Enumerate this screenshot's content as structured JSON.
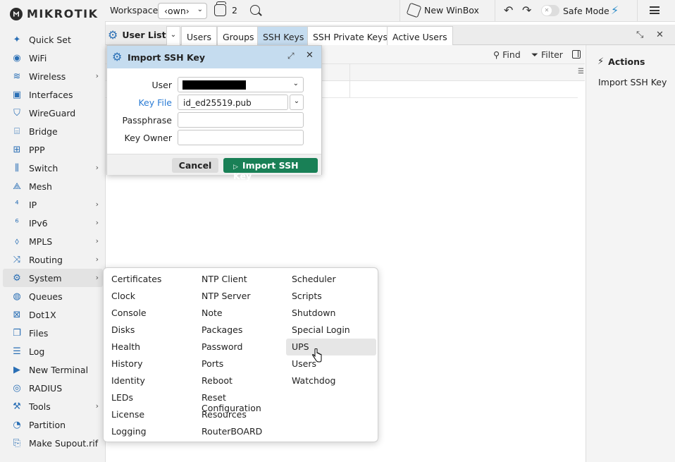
{
  "brand": "MIKROTIK",
  "sidebar": {
    "items": [
      {
        "label": "Quick Set",
        "icon": "magic-wand-icon",
        "glyph": "✦",
        "chevron": false
      },
      {
        "label": "WiFi",
        "icon": "wifi-icon",
        "glyph": "◉",
        "chevron": false
      },
      {
        "label": "Wireless",
        "icon": "wireless-icon",
        "glyph": "≋",
        "chevron": true
      },
      {
        "label": "Interfaces",
        "icon": "interfaces-icon",
        "glyph": "▣",
        "chevron": false
      },
      {
        "label": "WireGuard",
        "icon": "wireguard-shield-icon",
        "glyph": "⛉",
        "chevron": false
      },
      {
        "label": "Bridge",
        "icon": "bridge-icon",
        "glyph": "⌸",
        "chevron": false
      },
      {
        "label": "PPP",
        "icon": "ppp-icon",
        "glyph": "⊞",
        "chevron": false
      },
      {
        "label": "Switch",
        "icon": "switch-icon",
        "glyph": "⫼",
        "chevron": true
      },
      {
        "label": "Mesh",
        "icon": "mesh-icon",
        "glyph": "⟁",
        "chevron": false
      },
      {
        "label": "IP",
        "icon": "ip-icon",
        "glyph": "⁴",
        "chevron": true
      },
      {
        "label": "IPv6",
        "icon": "ipv6-icon",
        "glyph": "⁶",
        "chevron": true
      },
      {
        "label": "MPLS",
        "icon": "mpls-tag-icon",
        "glyph": "⬨",
        "chevron": true
      },
      {
        "label": "Routing",
        "icon": "routing-icon",
        "glyph": "⤨",
        "chevron": true
      },
      {
        "label": "System",
        "icon": "system-gear-icon",
        "glyph": "⚙",
        "chevron": true,
        "active": true
      },
      {
        "label": "Queues",
        "icon": "queues-icon",
        "glyph": "◍",
        "chevron": false
      },
      {
        "label": "Dot1X",
        "icon": "dot1x-icon",
        "glyph": "⊠",
        "chevron": false
      },
      {
        "label": "Files",
        "icon": "files-icon",
        "glyph": "❐",
        "chevron": false
      },
      {
        "label": "Log",
        "icon": "log-icon",
        "glyph": "☰",
        "chevron": false
      },
      {
        "label": "New Terminal",
        "icon": "terminal-icon",
        "glyph": "▶",
        "chevron": false
      },
      {
        "label": "RADIUS",
        "icon": "radius-icon",
        "glyph": "◎",
        "chevron": false
      },
      {
        "label": "Tools",
        "icon": "tools-icon",
        "glyph": "⚒",
        "chevron": true
      },
      {
        "label": "Partition",
        "icon": "partition-icon",
        "glyph": "◔",
        "chevron": false
      },
      {
        "label": "Make Supout.rif",
        "icon": "supout-file-icon",
        "glyph": "⎘",
        "chevron": false
      }
    ]
  },
  "topbar": {
    "workspace_label": "Workspace:",
    "workspace_value": "‹own›",
    "window_count": "2",
    "new_winbox": "New WinBox",
    "safe_mode": "Safe Mode"
  },
  "tabs": {
    "first": "User List",
    "items": [
      "Users",
      "Groups",
      "SSH Keys",
      "SSH Private Keys",
      "Active Users"
    ],
    "active": "SSH Keys"
  },
  "toolbar": {
    "find": "Find",
    "filter": "Filter"
  },
  "actions": {
    "title": "Actions",
    "items": [
      "Import SSH Key"
    ]
  },
  "dialog": {
    "title": "Import SSH Key",
    "fields": {
      "user_label": "User",
      "key_file_label": "Key File",
      "key_file_value": "id_ed25519.pub",
      "passphrase_label": "Passphrase",
      "key_owner_label": "Key Owner"
    },
    "cancel": "Cancel",
    "import": "Import SSH Key"
  },
  "system_menu": {
    "col1": [
      "Certificates",
      "Clock",
      "Console",
      "Disks",
      "Health",
      "History",
      "Identity",
      "LEDs",
      "License",
      "Logging"
    ],
    "col2": [
      "NTP Client",
      "NTP Server",
      "Note",
      "Packages",
      "Password",
      "Ports",
      "Reboot",
      "Reset Configuration",
      "Resources",
      "RouterBOARD"
    ],
    "col3": [
      "Scheduler",
      "Scripts",
      "Shutdown",
      "Special Login",
      "UPS",
      "Users",
      "Watchdog"
    ],
    "hovered": "UPS"
  },
  "colors": {
    "accent": "#2a6fb5",
    "tab_active": "#c5dcef",
    "import_button": "#198056",
    "link_label": "#2a7bd4"
  }
}
